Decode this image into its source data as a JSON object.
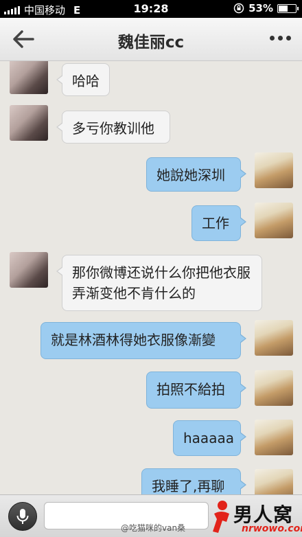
{
  "status_bar": {
    "carrier": "中国移动",
    "network": "E",
    "time": "19:28",
    "battery": "53%",
    "icons": [
      "signal-icon",
      "rotation-lock-icon",
      "battery-icon"
    ]
  },
  "header": {
    "title": "魏佳丽cc",
    "back_icon": "back-arrow-icon",
    "more_icon": "more-dots-icon"
  },
  "messages": [
    {
      "side": "in",
      "text": "哈哈"
    },
    {
      "side": "in",
      "text": "多亏你教训他"
    },
    {
      "side": "out",
      "text": "她說她深圳"
    },
    {
      "side": "out",
      "text": "工作"
    },
    {
      "side": "in",
      "text": "那你微博还说什么你把他衣服弄渐变他不肯什么的"
    },
    {
      "side": "out",
      "text": "就是林酒林得她衣服像漸變"
    },
    {
      "side": "out",
      "text": "拍照不給拍"
    },
    {
      "side": "out",
      "text": "haaaaa"
    },
    {
      "side": "out",
      "text": "我睡了,再聊"
    }
  ],
  "input_bar": {
    "mic_icon": "microphone-icon",
    "text_value": ""
  },
  "watermark": {
    "handle": "@吃猫咪的van桑",
    "logo_cn": "男人窝",
    "logo_en": "nrwowo.com"
  },
  "colors": {
    "outgoing_bubble": "#9cccf0",
    "incoming_bubble": "#f4f4f4",
    "chat_background": "#e9e7e2"
  }
}
